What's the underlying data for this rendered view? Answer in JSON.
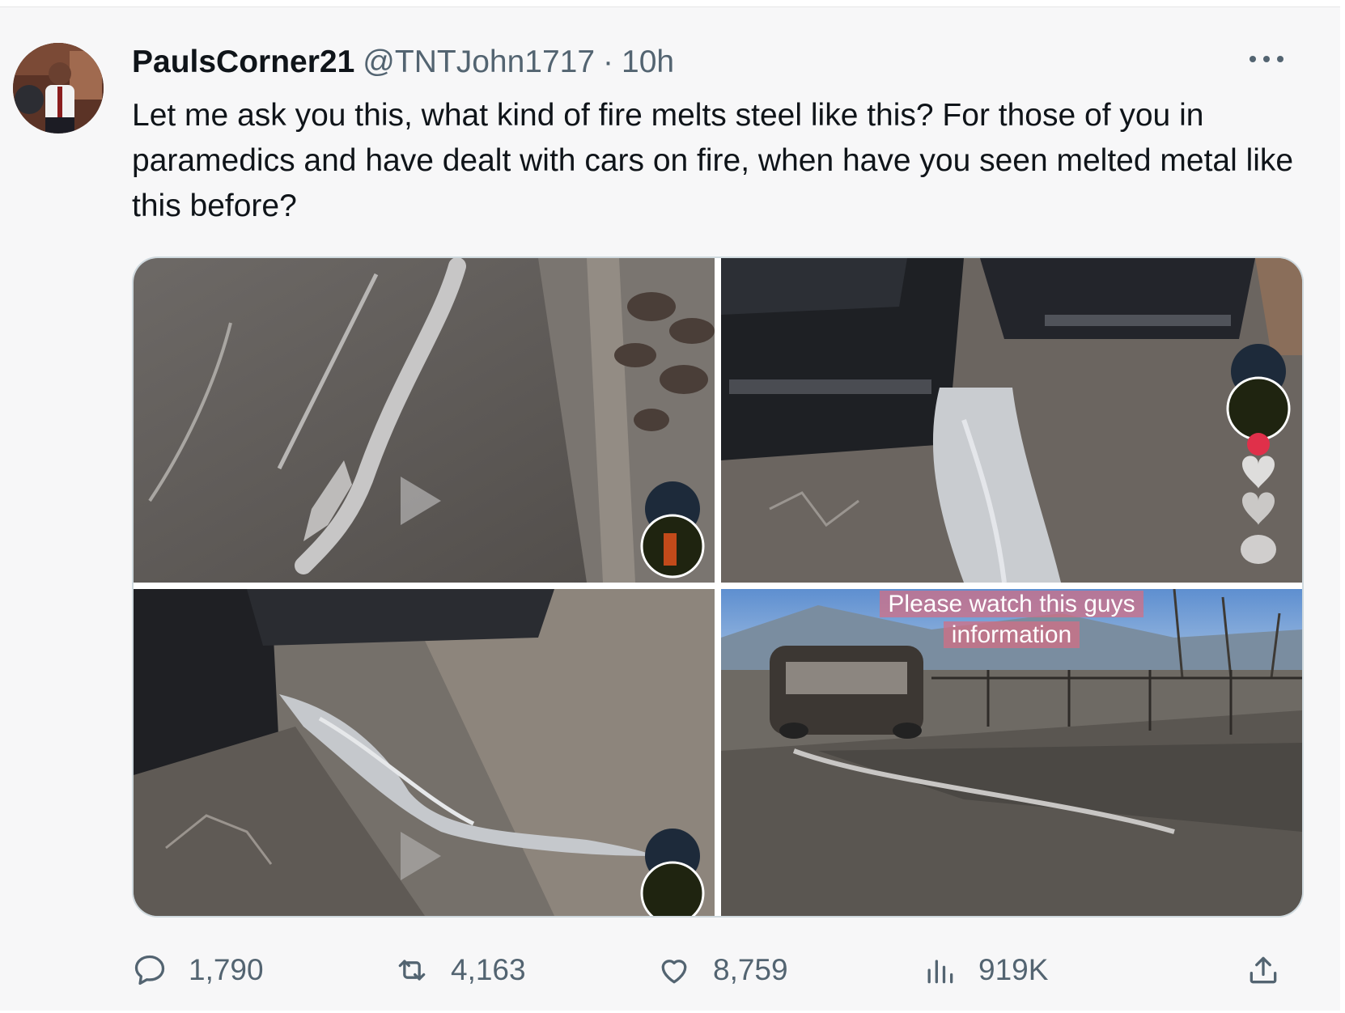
{
  "tweet": {
    "display_name": "PaulsCorner21",
    "handle": "@TNTJohn1717",
    "separator": "·",
    "time": "10h",
    "text": "Let me ask you this, what kind of fire melts steel like this? For those of you in paramedics and have dealt with cars on fire, when have you seen melted metal like this before?",
    "media_overlay_text": [
      "Please watch this guys",
      "information"
    ]
  },
  "stats": {
    "replies": "1,790",
    "reposts": "4,163",
    "likes": "8,759",
    "views": "919K"
  },
  "icons": {
    "more": "more-horizontal-icon",
    "reply": "speech-bubble-icon",
    "repost": "repost-arrows-icon",
    "like": "heart-icon",
    "views": "bar-chart-icon",
    "share": "share-upload-icon",
    "play": "play-icon"
  },
  "colors": {
    "secondary_text": "#536471",
    "primary_text": "#0f1419",
    "card_background": "#f7f7f8"
  }
}
